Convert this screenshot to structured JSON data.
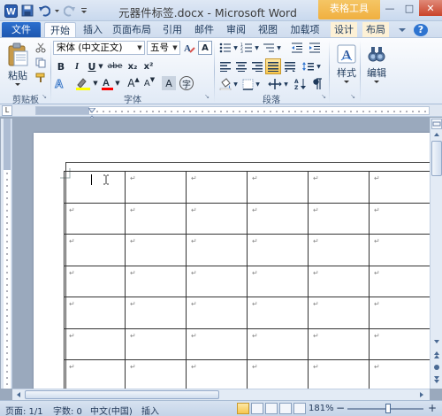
{
  "titlebar": {
    "doc_title": "元器件标签.docx - Microsoft Word",
    "context_tab_title": "表格工具",
    "controls": {
      "minimize": "—",
      "maximize": "□",
      "close": "✕"
    }
  },
  "tabs": {
    "file": "文件",
    "items": [
      "开始",
      "插入",
      "页面布局",
      "引用",
      "邮件",
      "审阅",
      "视图",
      "加载项",
      "设计",
      "布局"
    ],
    "help": "?"
  },
  "ribbon": {
    "clipboard": {
      "paste": "粘贴",
      "group": "剪贴板"
    },
    "font": {
      "font_name": "宋体 (中文正文)",
      "font_size": "五号",
      "group": "字体",
      "bold": "B",
      "italic": "I",
      "underline": "U",
      "strike": "abe",
      "subscript": "x₂",
      "superscript": "x²",
      "grow": "A",
      "shrink": "A",
      "char_shade": "A",
      "enclose": "字"
    },
    "paragraph": {
      "group": "段落"
    },
    "styles": {
      "label": "样式",
      "group": "样式"
    },
    "editing": {
      "label": "编辑"
    }
  },
  "ruler": {
    "left_marker": "L"
  },
  "document": {
    "paragraph_mark": "↵",
    "rows": 8,
    "cols": 6
  },
  "statusbar": {
    "page": "页面: 1/1",
    "words": "字数: 0",
    "language": "中文(中国)",
    "mode": "插入",
    "zoom": "181%",
    "zoom_minus": "−",
    "zoom_plus": "+"
  },
  "colors": {
    "file_tab": "#2b6fcf",
    "context_tab": "#f0b040",
    "highlight": "#ffff00",
    "font_color": "#ff0000"
  }
}
